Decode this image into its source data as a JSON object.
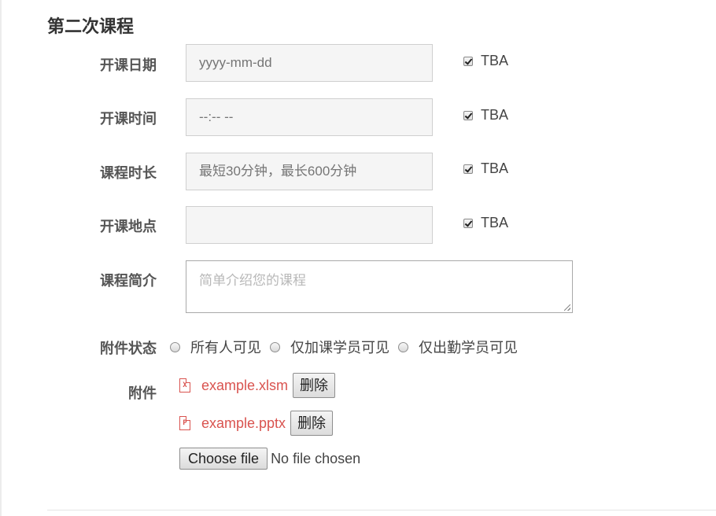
{
  "section": {
    "title": "第二次课程"
  },
  "fields": [
    {
      "label": "开课日期",
      "placeholder": "yyyy-mm-dd",
      "tba": "TBA"
    },
    {
      "label": "开课时间",
      "placeholder": "--:-- --",
      "tba": "TBA"
    },
    {
      "label": "课程时长",
      "placeholder": "最短30分钟，最长600分钟",
      "tba": "TBA"
    },
    {
      "label": "开课地点",
      "placeholder": "",
      "tba": "TBA"
    }
  ],
  "intro": {
    "label": "课程简介",
    "placeholder": "简单介绍您的课程"
  },
  "visibility": {
    "label": "附件状态",
    "options": [
      "所有人可见",
      "仅加课学员可见",
      "仅出勤学员可见"
    ]
  },
  "attachments": {
    "label": "附件",
    "files": [
      {
        "name": "example.xlsm",
        "icon_glyph": "X",
        "icon": "excel-file-icon",
        "delete_label": "删除"
      },
      {
        "name": "example.pptx",
        "icon_glyph": "P",
        "icon": "powerpoint-file-icon",
        "delete_label": "删除"
      }
    ],
    "chooser_button": "Choose file",
    "chooser_status": "No file chosen"
  },
  "colors": {
    "file_link": "#d9534f",
    "input_bg": "#f5f5f5"
  }
}
